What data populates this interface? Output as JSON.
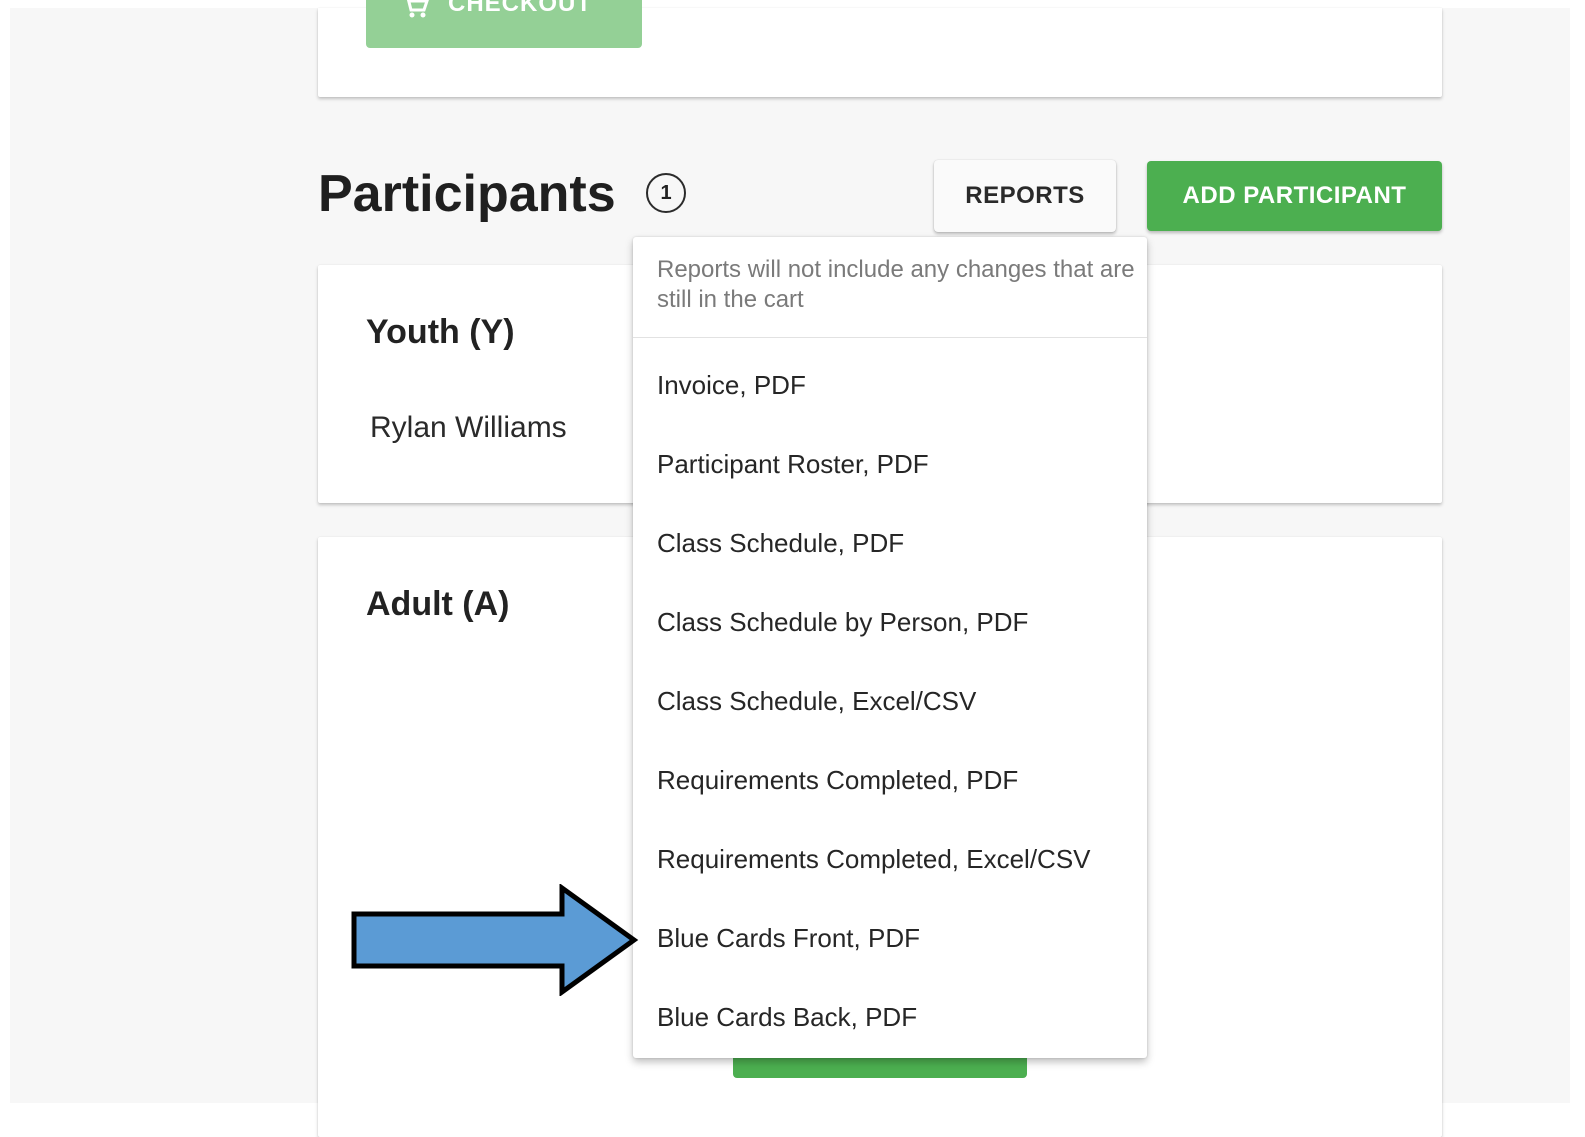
{
  "checkout": {
    "label": "CHECKOUT"
  },
  "participants": {
    "title": "Participants",
    "count": "1",
    "reports_label": "REPORTS",
    "add_label": "ADD PARTICIPANT"
  },
  "groups": [
    {
      "title": "Youth (Y)",
      "members": [
        "Rylan Williams"
      ]
    },
    {
      "title": "Adult (A)",
      "members": []
    }
  ],
  "reports_menu": {
    "note": "Reports will not include any changes that are still in the cart",
    "items": [
      "Invoice, PDF",
      "Participant Roster, PDF",
      "Class Schedule, PDF",
      "Class Schedule by Person, PDF",
      "Class Schedule, Excel/CSV",
      "Requirements Completed, PDF",
      "Requirements Completed, Excel/CSV",
      "Blue Cards Front, PDF",
      "Blue Cards Back, PDF"
    ]
  },
  "colors": {
    "primary_green": "#4caf50",
    "disabled_green": "#94d096",
    "annotation_arrow": "#5b9bd5"
  },
  "icons": {
    "checkout": "cart-icon",
    "annotation": "arrow-right-icon"
  }
}
